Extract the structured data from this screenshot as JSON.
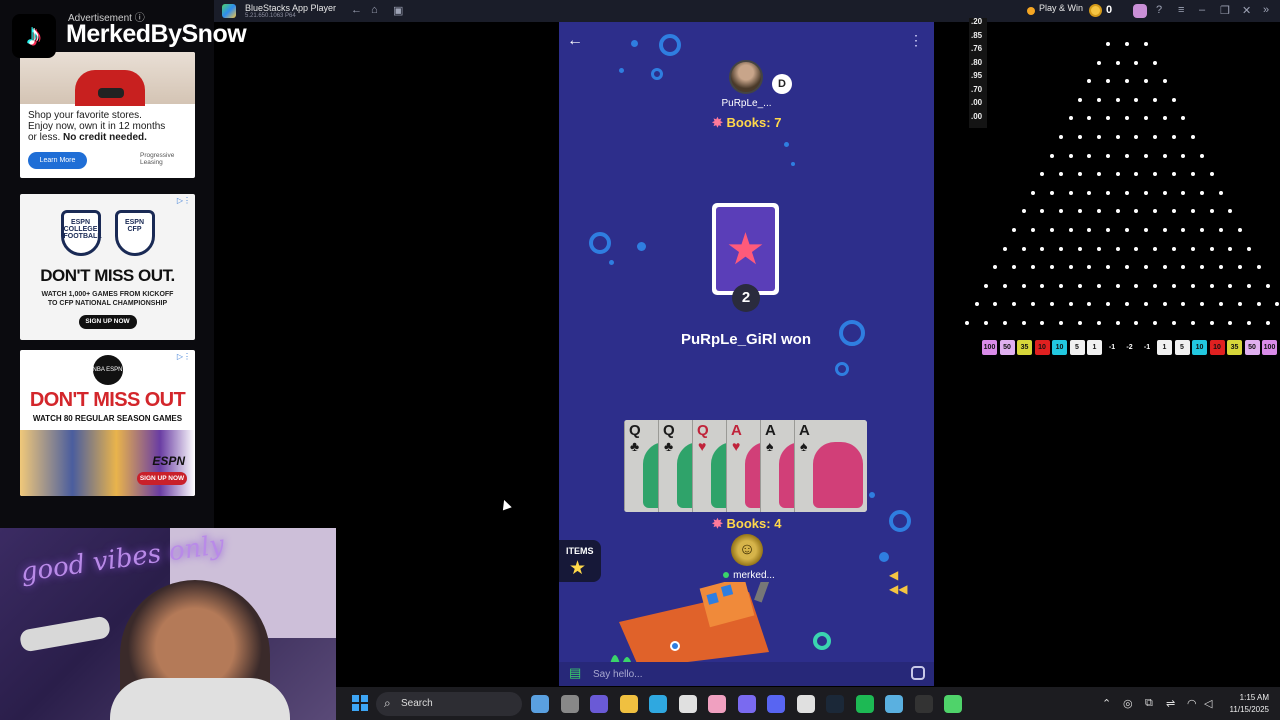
{
  "overlay": {
    "streamer_name": "MerkedBySnow",
    "logo_icon": "tiktok-icon"
  },
  "ads": {
    "label": "Advertisement ⓘ",
    "ad1": {
      "line1": "Shop your favorite stores.",
      "line2": "Enjoy now, own it in 12 months",
      "line3": "or less.",
      "line3_bold": "No credit needed.",
      "button": "Learn More",
      "brand": "Progressive Leasing"
    },
    "ad2": {
      "logo_left": "ESPN COLLEGE FOOTBALL",
      "logo_right": "ESPN CFP",
      "headline": "DON'T MISS OUT.",
      "sub1": "WATCH 1,000+ GAMES FROM KICKOFF",
      "sub2": "TO CFP NATIONAL CHAMPIONSHIP",
      "cta": "SIGN UP NOW"
    },
    "ad3": {
      "logo": "NBA ESPN",
      "headline": "DON'T MISS OUT",
      "sub": "WATCH 80 REGULAR SEASON GAMES",
      "brand": "ESPN",
      "cta": "SIGN UP NOW"
    }
  },
  "bluestacks": {
    "title": "BlueStacks App Player",
    "subtitle": "5.21.650.1063 P64",
    "play_win": "Play & Win",
    "coins": "0"
  },
  "game": {
    "opponent": {
      "name": "PuRpLe_...",
      "badge": "D",
      "books_label": "Books: 7"
    },
    "center_card_count": "2",
    "result_text": "PuRpLe_GiRl won",
    "hand": [
      {
        "rank": "Q",
        "suit": "♣",
        "color": "#1a1a1a",
        "art": "#2fa36a"
      },
      {
        "rank": "Q",
        "suit": "♣",
        "color": "#1a1a1a",
        "art": "#2fa36a"
      },
      {
        "rank": "Q",
        "suit": "♥",
        "color": "#c0233a",
        "art": "#2fa36a"
      },
      {
        "rank": "A",
        "suit": "♥",
        "color": "#c0233a",
        "art": "#d13f78"
      },
      {
        "rank": "A",
        "suit": "♠",
        "color": "#1a1a1a",
        "art": "#d13f78"
      },
      {
        "rank": "A",
        "suit": "♠",
        "color": "#1a1a1a",
        "art": "#d13f78"
      }
    ],
    "me": {
      "name": "merked...",
      "books_label": "Books: 4"
    },
    "items_label": "ITEMS",
    "chat_placeholder": "Say hello..."
  },
  "plinko": {
    "side_labels": [
      ".20",
      ".85",
      ".76",
      ".80",
      ".95",
      ".70",
      ".00",
      ".00"
    ],
    "slots": [
      {
        "v": "100",
        "c": "#d98be8"
      },
      {
        "v": "50",
        "c": "#e0b0f0"
      },
      {
        "v": "35",
        "c": "#d6d63a"
      },
      {
        "v": "10",
        "c": "#e02020"
      },
      {
        "v": "10",
        "c": "#22c8e0"
      },
      {
        "v": "5",
        "c": "#f0f0f0"
      },
      {
        "v": "1",
        "c": "#f0f0f0"
      },
      {
        "v": "-1",
        "c": ""
      },
      {
        "v": "-2",
        "c": ""
      },
      {
        "v": "-1",
        "c": ""
      },
      {
        "v": "1",
        "c": "#f0f0f0"
      },
      {
        "v": "5",
        "c": "#f0f0f0"
      },
      {
        "v": "10",
        "c": "#22c8e0"
      },
      {
        "v": "10",
        "c": "#e02020"
      },
      {
        "v": "35",
        "c": "#d6d63a"
      },
      {
        "v": "50",
        "c": "#e0b0f0"
      },
      {
        "v": "100",
        "c": "#d98be8"
      }
    ]
  },
  "webcam": {
    "neon_text": "good vibes only"
  },
  "taskbar": {
    "search_label": "Search",
    "time": "1:15 AM",
    "date": "11/15/2025",
    "apps": [
      {
        "name": "widgets-icon",
        "c": "#5aa0e0"
      },
      {
        "name": "task-view-icon",
        "c": "#888"
      },
      {
        "name": "teams-icon",
        "c": "#6a5ad6"
      },
      {
        "name": "file-explorer-icon",
        "c": "#f0c040"
      },
      {
        "name": "edge-icon",
        "c": "#2fa8e0"
      },
      {
        "name": "store-icon",
        "c": "#e0e0e0"
      },
      {
        "name": "photos-icon",
        "c": "#f0a0c0"
      },
      {
        "name": "copilot-icon",
        "c": "#7a6af0"
      },
      {
        "name": "discord-icon",
        "c": "#5865f2"
      },
      {
        "name": "chrome-icon",
        "c": "#e0e0e0"
      },
      {
        "name": "steam-icon",
        "c": "#1b2838"
      },
      {
        "name": "spotify-icon",
        "c": "#1db954"
      },
      {
        "name": "notepad-icon",
        "c": "#5ab0e0"
      },
      {
        "name": "epic-games-icon",
        "c": "#333"
      },
      {
        "name": "bluestacks-icon",
        "c": "#4fd36a"
      }
    ]
  }
}
